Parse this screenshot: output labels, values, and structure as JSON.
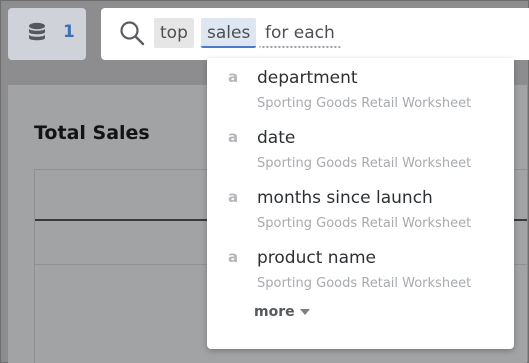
{
  "source_button": {
    "icon": "database-icon",
    "count": "1"
  },
  "search": {
    "icon": "search-icon",
    "tokens": [
      "top",
      "sales"
    ],
    "input_value": "for each"
  },
  "card": {
    "title": "Total Sales"
  },
  "dropdown": {
    "suggestions": [
      {
        "type": "a",
        "name": "department",
        "source": "Sporting Goods Retail Worksheet"
      },
      {
        "type": "a",
        "name": "date",
        "source": "Sporting Goods Retail Worksheet"
      },
      {
        "type": "a",
        "name": "months since launch",
        "source": "Sporting Goods Retail Worksheet"
      },
      {
        "type": "a",
        "name": "product name",
        "source": "Sporting Goods Retail Worksheet"
      }
    ],
    "more_label": "more",
    "more_icon": "caret-down-icon"
  },
  "colors": {
    "accent": "#4a7bd0",
    "overlay": "#8d8d8f"
  }
}
